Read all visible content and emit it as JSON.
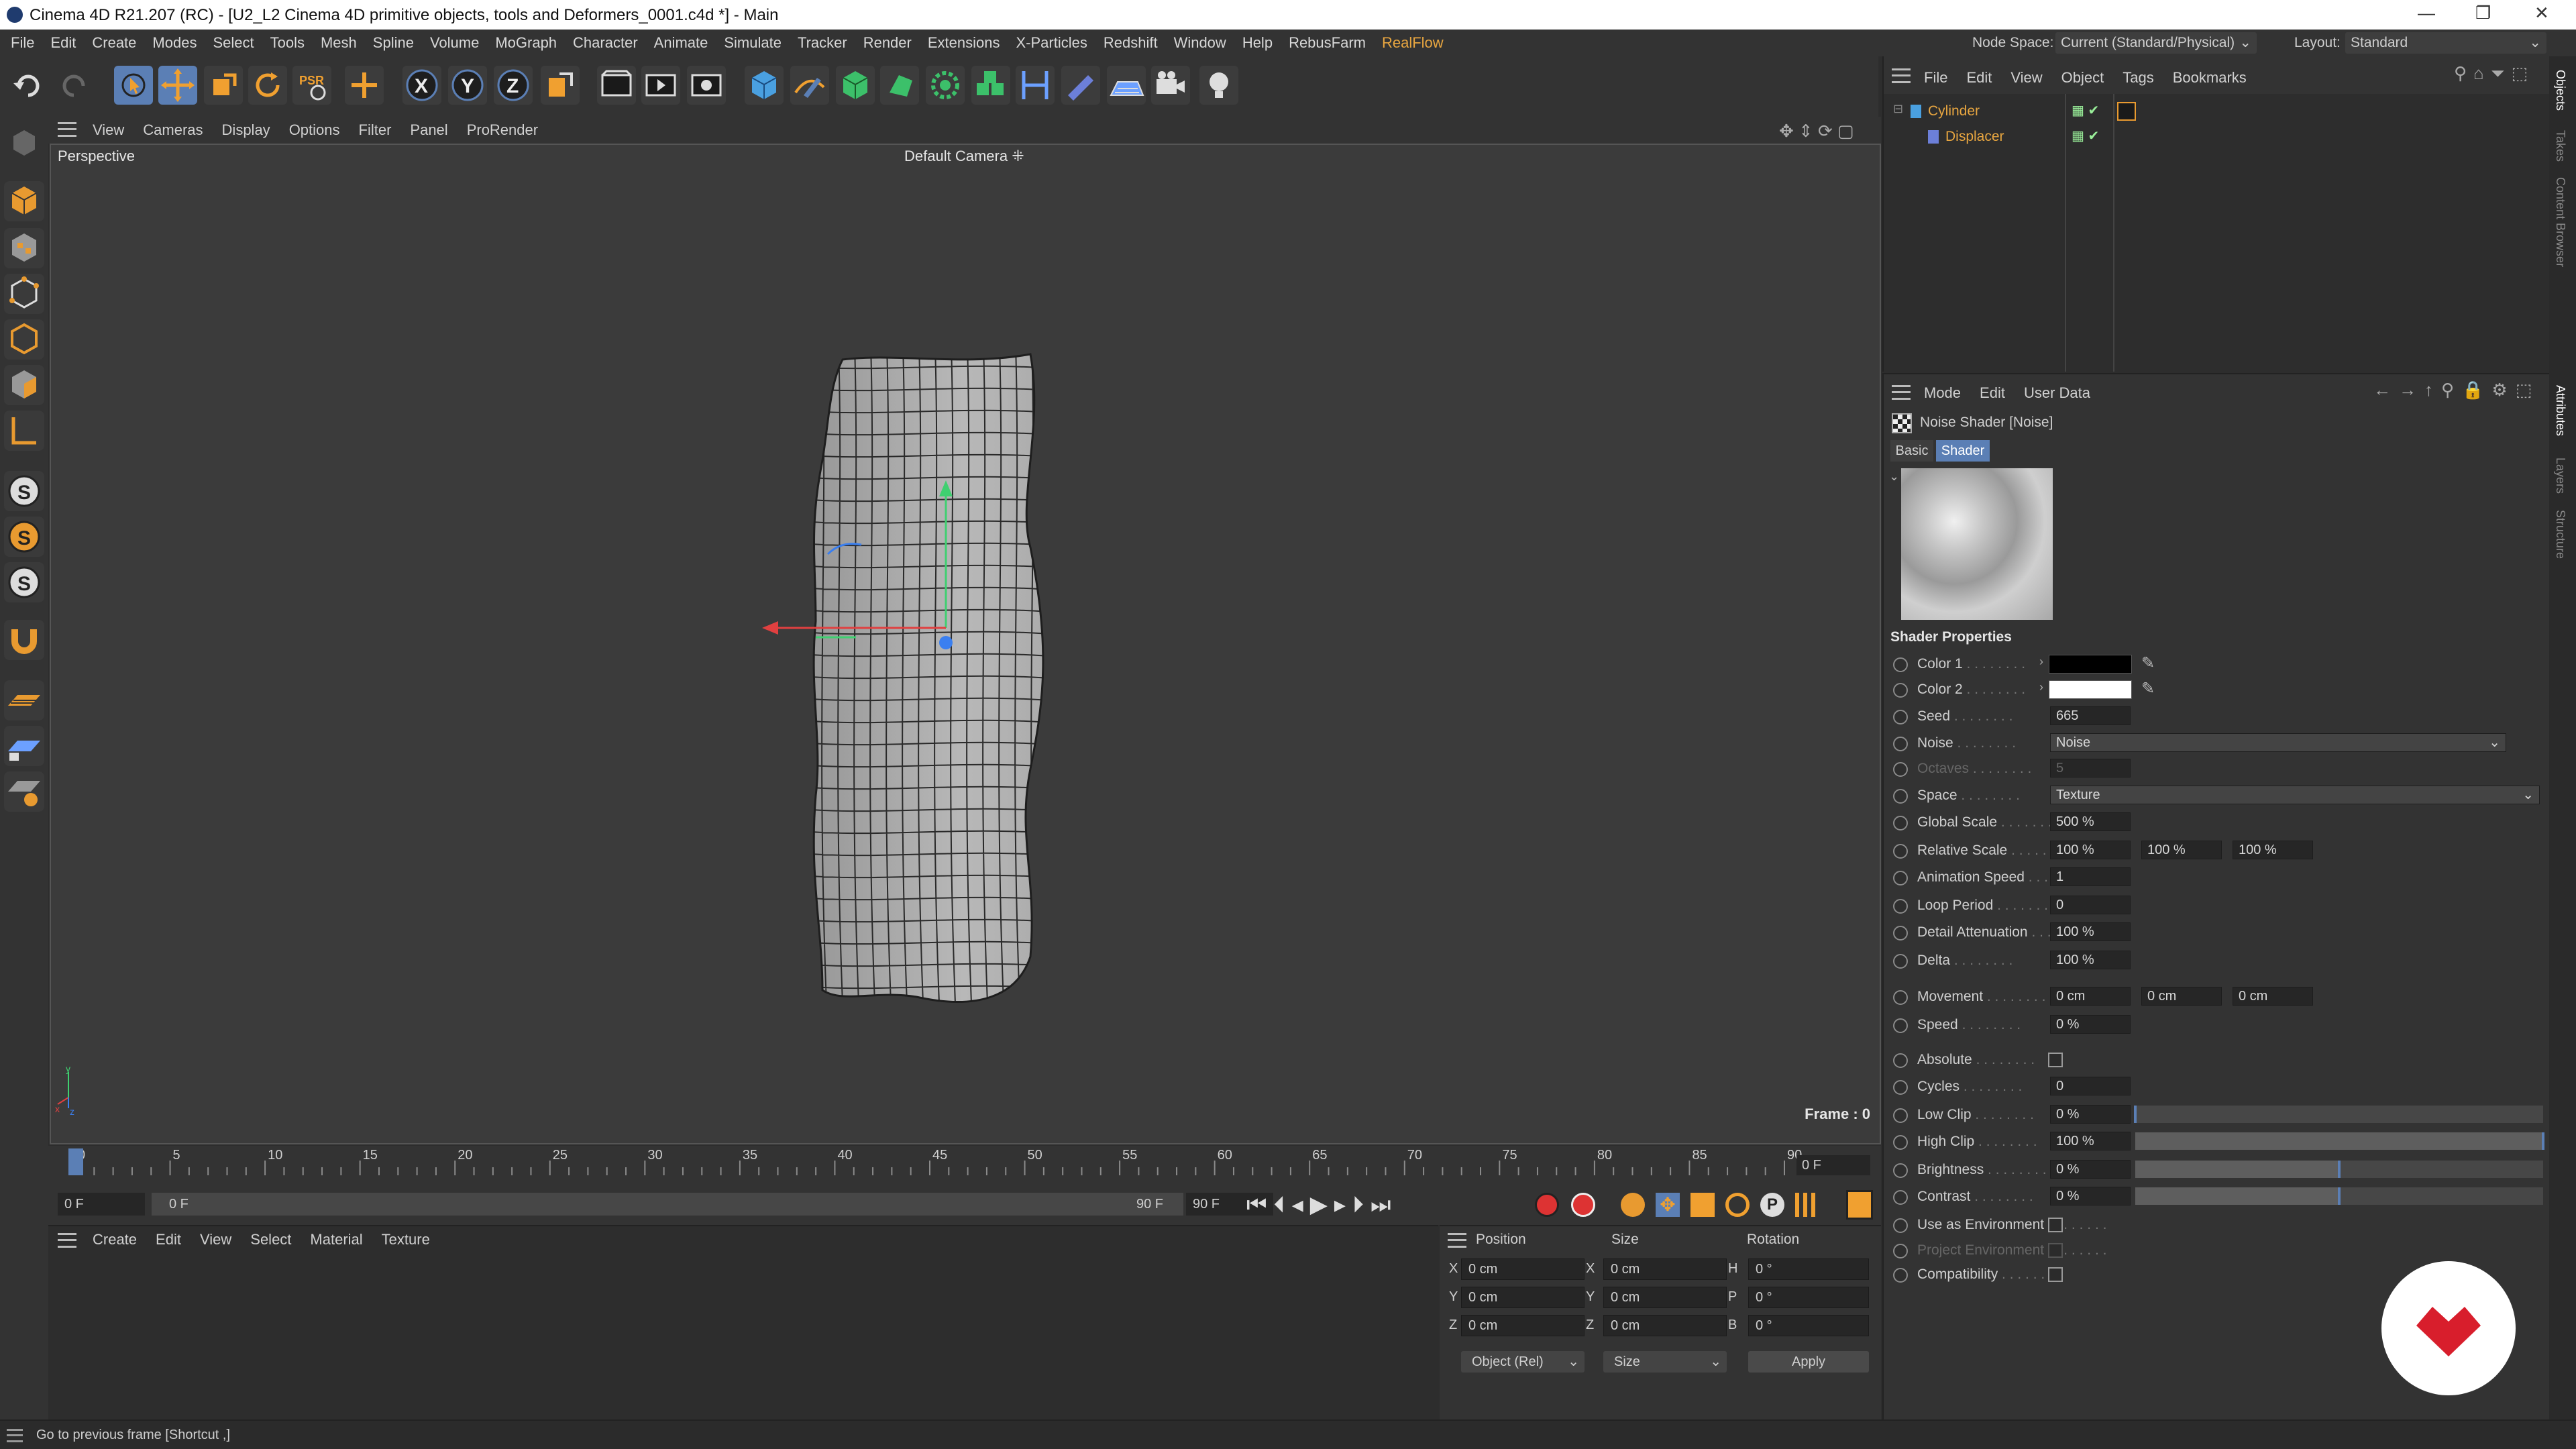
{
  "window": {
    "title": "Cinema 4D R21.207 (RC) - [U2_L2 Cinema 4D primitive objects, tools and  Deformers_0001.c4d *] - Main",
    "controls": [
      "—",
      "❐",
      "✕"
    ]
  },
  "menu": {
    "items": [
      "File",
      "Edit",
      "Create",
      "Modes",
      "Select",
      "Tools",
      "Mesh",
      "Spline",
      "Volume",
      "MoGraph",
      "Character",
      "Animate",
      "Simulate",
      "Tracker",
      "Render",
      "Extensions",
      "X-Particles",
      "Redshift",
      "Window",
      "Help",
      "RebusFarm",
      "RealFlow"
    ],
    "node_space_label": "Node Space:",
    "node_space_value": "Current (Standard/Physical)",
    "layout_label": "Layout:",
    "layout_value": "Standard"
  },
  "viewport": {
    "menu": [
      "View",
      "Cameras",
      "Display",
      "Options",
      "Filter",
      "Panel",
      "ProRender"
    ],
    "label": "Perspective",
    "camera": "Default Camera",
    "frame_text": "Frame : 0",
    "axis": {
      "x": "x",
      "y": "y",
      "z": "z"
    }
  },
  "timeline": {
    "ticks": [
      "0",
      "5",
      "10",
      "15",
      "20",
      "25",
      "30",
      "35",
      "40",
      "45",
      "50",
      "55",
      "60",
      "65",
      "70",
      "75",
      "80",
      "85",
      "90"
    ],
    "current_box": "0 F",
    "start": "0 F",
    "range_start": "0 F",
    "range_end": "90 F",
    "end": "90 F",
    "play_position": 0
  },
  "materials": {
    "menu": [
      "Create",
      "Edit",
      "View",
      "Select",
      "Material",
      "Texture"
    ]
  },
  "coords": {
    "headers": [
      "Position",
      "Size",
      "Rotation"
    ],
    "rows": [
      {
        "a": "X",
        "pos": "0 cm",
        "b": "X",
        "size": "0 cm",
        "c": "H",
        "rot": "0 °"
      },
      {
        "a": "Y",
        "pos": "0 cm",
        "b": "Y",
        "size": "0 cm",
        "c": "P",
        "rot": "0 °"
      },
      {
        "a": "Z",
        "pos": "0 cm",
        "b": "Z",
        "size": "0 cm",
        "c": "B",
        "rot": "0 °"
      }
    ],
    "mode": "Object (Rel)",
    "size_mode": "Size",
    "apply": "Apply"
  },
  "objects": {
    "menu": [
      "File",
      "Edit",
      "View",
      "Object",
      "Tags",
      "Bookmarks"
    ],
    "items": [
      {
        "name": "Cylinder",
        "color": "#e8a640"
      },
      {
        "name": "Displacer",
        "color": "#e8a640"
      }
    ]
  },
  "attributes": {
    "menu": [
      "Mode",
      "Edit",
      "User Data"
    ],
    "title": "Noise Shader [Noise]",
    "tabs": [
      "Basic",
      "Shader"
    ],
    "active_tab": "Shader",
    "section": "Shader Properties",
    "color1": "#000000",
    "color2": "#ffffff",
    "props": {
      "color1": "Color 1",
      "color2": "Color 2",
      "seed": "Seed",
      "seed_v": "665",
      "noise": "Noise",
      "noise_v": "Noise",
      "octaves": "Octaves",
      "octaves_v": "5",
      "space": "Space",
      "space_v": "Texture",
      "global_scale": "Global Scale",
      "global_scale_v": "500 %",
      "relative_scale": "Relative Scale",
      "rs1": "100 %",
      "rs2": "100 %",
      "rs3": "100 %",
      "anim_speed": "Animation Speed",
      "anim_speed_v": "1",
      "loop_period": "Loop Period",
      "loop_period_v": "0",
      "detail_att": "Detail Attenuation",
      "detail_att_v": "100 %",
      "delta": "Delta",
      "delta_v": "100 %",
      "movement": "Movement",
      "mv1": "0 cm",
      "mv2": "0 cm",
      "mv3": "0 cm",
      "speed": "Speed",
      "speed_v": "0 %",
      "absolute": "Absolute",
      "cycles": "Cycles",
      "cycles_v": "0",
      "low_clip": "Low Clip",
      "low_clip_v": "0 %",
      "high_clip": "High Clip",
      "high_clip_v": "100 %",
      "brightness": "Brightness",
      "brightness_v": "0 %",
      "contrast": "Contrast",
      "contrast_v": "0 %",
      "use_env": "Use as Environment",
      "proj_env": "Project Environment",
      "compat": "Compatibility"
    },
    "levels": {
      "low_clip": 0,
      "high_clip": 1,
      "brightness": 0.5,
      "contrast": 0.5
    }
  },
  "side_tabs": {
    "top": [
      "Objects",
      "Takes",
      "Content Browser"
    ],
    "bottom": [
      "Attributes",
      "Layers",
      "Structure"
    ]
  },
  "status": {
    "text": "Go to previous frame [Shortcut ,]"
  }
}
